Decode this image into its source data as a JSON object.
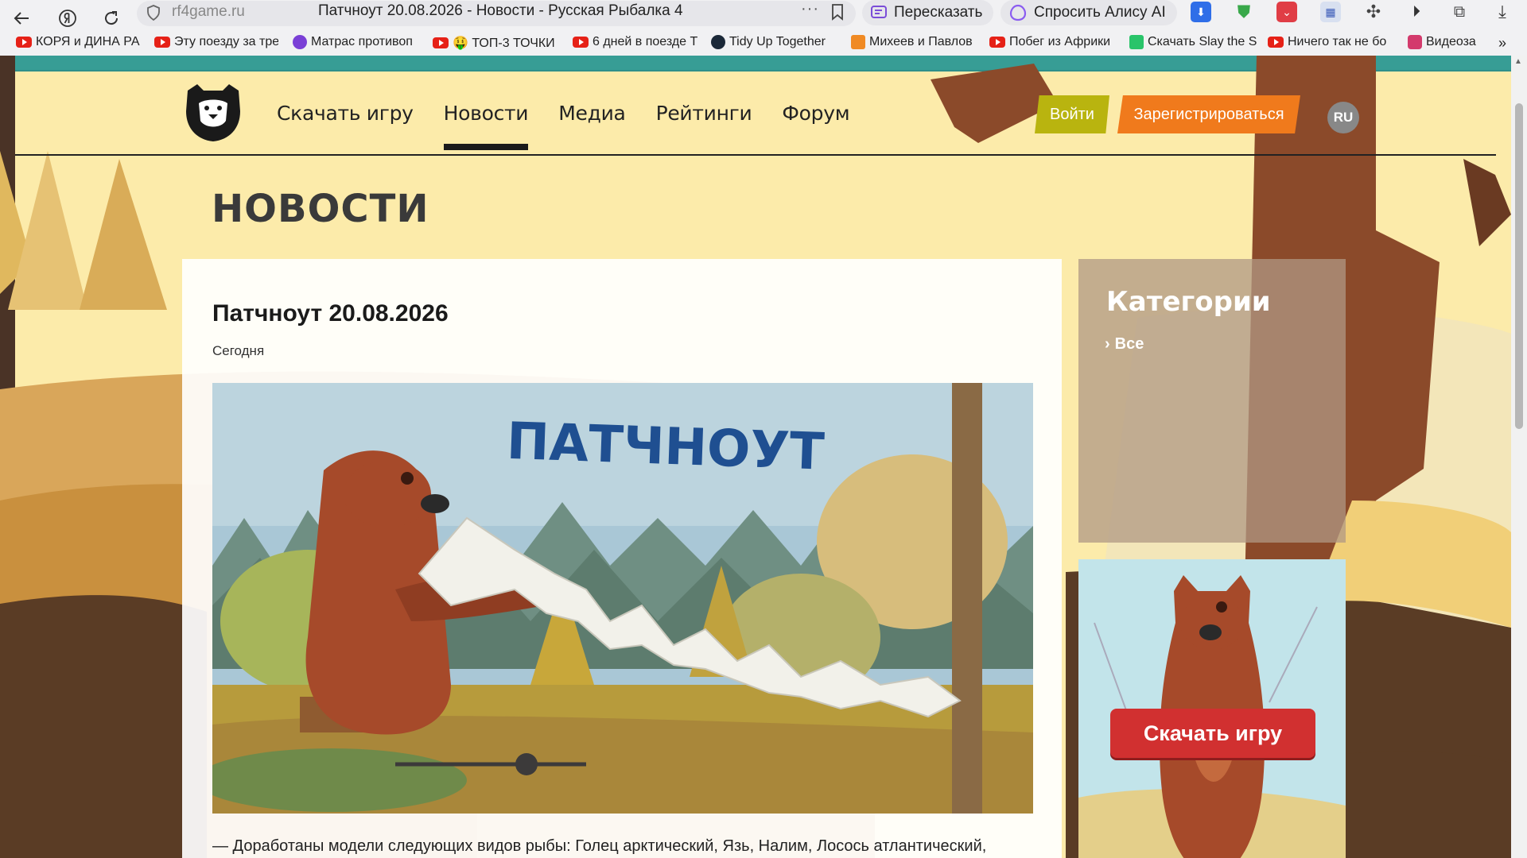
{
  "browser": {
    "url_host": "rf4game.ru",
    "tab_title": "Патчноут 20.08.2026 - Новости - Русская Рыбалка 4",
    "retell_label": "Пересказать",
    "ask_alice_label": "Спросить Алису AI",
    "bookmarks": [
      {
        "label": "КОРЯ и ДИНА РА",
        "icon": "youtube-icon"
      },
      {
        "label": "Эту поезду за тре",
        "icon": "youtube-icon"
      },
      {
        "label": "Матрас противоп",
        "icon": "purple-app-icon"
      },
      {
        "label": "🤑 ТОП-3 ТОЧКИ",
        "icon": "youtube-icon"
      },
      {
        "label": "6 дней в поезде Т",
        "icon": "youtube-icon"
      },
      {
        "label": "Tidy Up Together",
        "icon": "steam-icon"
      },
      {
        "label": "Михеев и Павлов",
        "icon": "orange-app-icon"
      },
      {
        "label": "Побег из Африки",
        "icon": "youtube-icon"
      },
      {
        "label": "Скачать Slay the S",
        "icon": "green-app-icon"
      },
      {
        "label": "Ничего так не бо",
        "icon": "youtube-icon"
      },
      {
        "label": "Видеоза",
        "icon": "video-app-icon"
      }
    ],
    "more_bookmarks": "»"
  },
  "site": {
    "nav": [
      {
        "label": "Скачать игру",
        "active": false
      },
      {
        "label": "Новости",
        "active": true
      },
      {
        "label": "Медиа",
        "active": false
      },
      {
        "label": "Рейтинги",
        "active": false
      },
      {
        "label": "Форум",
        "active": false
      }
    ],
    "login_label": "Войти",
    "register_label": "Зарегистрироваться",
    "lang_label": "RU",
    "section_heading": "НОВОСТИ"
  },
  "article": {
    "title": "Патчноут 20.08.2026",
    "date": "Сегодня",
    "image_heading": "ПАТЧНОУТ",
    "text": "— Доработаны модели следующих видов рыбы: Голец арктический, Язь, Налим, Лосось атлантический,"
  },
  "sidebar": {
    "categories_title": "Категории",
    "category_all": "Все",
    "promo_button": "Скачать игру"
  },
  "colors": {
    "login": "#b9b40f",
    "register": "#f07a1c",
    "promo": "#d13030",
    "image_heading": "#1f4f91"
  }
}
